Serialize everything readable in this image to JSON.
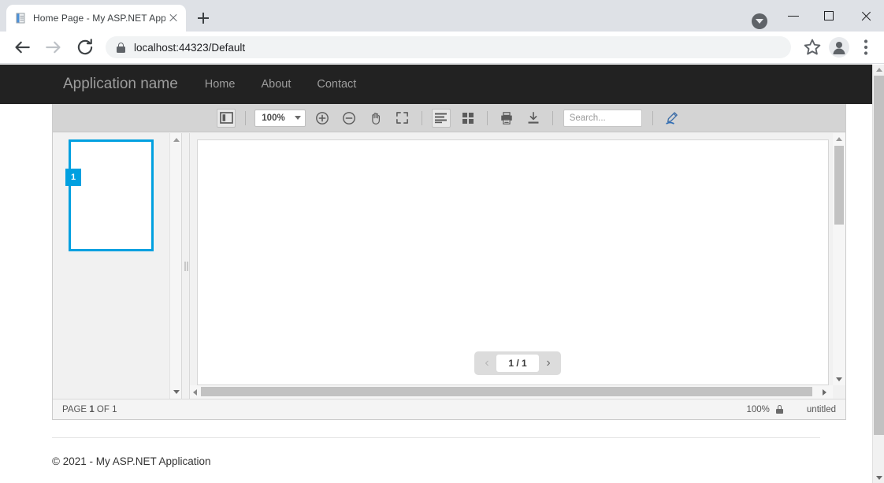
{
  "browser": {
    "tab": {
      "title": "Home Page - My ASP.NET Applic",
      "favicon": "document-icon",
      "close": "close-icon"
    },
    "new_tab_label": "+",
    "nav": {
      "back": "back-arrow-icon",
      "forward": "forward-arrow-icon",
      "reload": "reload-icon"
    },
    "url": "localhost:44323/Default",
    "url_security": "lock-icon",
    "omni_icons": [
      "star-icon",
      "profile-icon",
      "more-menu-icon"
    ],
    "window_controls": {
      "download": "download-indicator-icon",
      "minimize": "minimize-icon",
      "maximize": "maximize-icon",
      "close": "close-icon"
    }
  },
  "site": {
    "brand": "Application name",
    "nav_links": [
      "Home",
      "About",
      "Contact"
    ],
    "footer": "© 2021 - My ASP.NET Application"
  },
  "viewer": {
    "toolbar": {
      "sidebar_toggle": "sidebar-panel-icon",
      "zoom_value": "100%",
      "zoom_in": "zoom-in-icon",
      "zoom_out": "zoom-out-icon",
      "pan": "hand-pan-icon",
      "fullscreen": "fullscreen-icon",
      "continuous_view": "continuous-page-view-icon",
      "grid_view": "grid-page-view-icon",
      "print": "print-icon",
      "download": "download-icon",
      "search_placeholder": "Search...",
      "search_value": "",
      "annotate": "pen-highlight-icon"
    },
    "thumbnails": [
      {
        "page_number": "1",
        "selected": true
      }
    ],
    "page_nav": {
      "prev": "‹",
      "next": "›",
      "current": "1 / 1"
    },
    "status": {
      "page_label_prefix": "PAGE",
      "page_current": "1",
      "page_label_middle": "OF",
      "page_total": "1",
      "zoom": "100%",
      "lock": "lock-icon",
      "document_name": "untitled"
    }
  },
  "colors": {
    "accent_blue": "#00a0e0",
    "navbar_dark": "#222222",
    "toolbar_grey": "#d4d4d4",
    "panel_grey": "#f1f1f1"
  }
}
